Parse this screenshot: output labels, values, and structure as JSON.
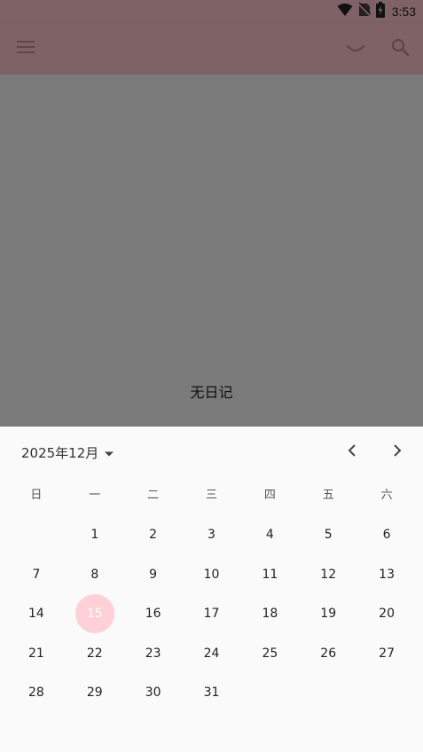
{
  "status_bar": {
    "time": "3:53",
    "icons": [
      "wifi-icon",
      "no-sim-icon",
      "battery-charging-icon"
    ]
  },
  "app_bar": {
    "icons": [
      "menu-icon",
      "smile-icon",
      "search-icon"
    ]
  },
  "content": {
    "empty_text": "无日记"
  },
  "calendar": {
    "month_label": "2025年12月",
    "weekdays": [
      "日",
      "一",
      "二",
      "三",
      "四",
      "五",
      "六"
    ],
    "leading_blanks": 1,
    "days": [
      "1",
      "2",
      "3",
      "4",
      "5",
      "6",
      "7",
      "8",
      "9",
      "10",
      "11",
      "12",
      "13",
      "14",
      "15",
      "16",
      "17",
      "18",
      "19",
      "20",
      "21",
      "22",
      "23",
      "24",
      "25",
      "26",
      "27",
      "28",
      "29",
      "30",
      "31"
    ],
    "selected_day": "15"
  },
  "colors": {
    "scrim_app_bar": "#7e6266",
    "scrim_content": "#7a7a7a",
    "sheet_background": "#fafafa",
    "selected_day_fill": "#ffd0d6"
  }
}
